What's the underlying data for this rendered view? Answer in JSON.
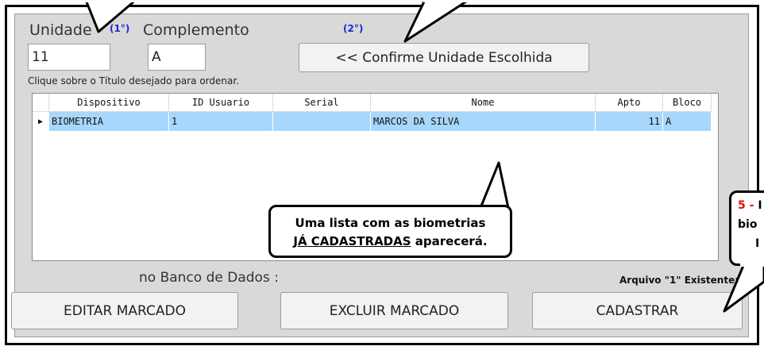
{
  "form": {
    "unidade_label": "Unidade",
    "unidade_tag": "(1°)",
    "complemento_label": "Complemento",
    "confirm_tag": "(2°)",
    "unidade_value": "11",
    "complemento_value": "A",
    "confirm_button": "<< Confirme Unidade Escolhida",
    "sort_hint": "Clique sobre o Título desejado para ordenar."
  },
  "grid": {
    "columns": [
      "Dispositivo",
      "ID Usuario",
      "Serial",
      "Nome",
      "Apto",
      "Bloco"
    ],
    "rows": [
      {
        "dispositivo": "BIOMETRIA",
        "id_usuario": "1",
        "serial": "",
        "nome": "MARCOS DA SILVA",
        "apto": "11",
        "bloco": "A"
      }
    ]
  },
  "status": {
    "banco_label": "no Banco de Dados :",
    "arquivo_label": "Arquivo \"1\" Existente:"
  },
  "actions": {
    "editar": "EDITAR MARCADO",
    "excluir": "EXCLUIR MARCADO",
    "cadastrar": "CADASTRAR"
  },
  "annotations": {
    "callout_line1": "Uma lista com as biometrias",
    "callout_line2_underlined": "JÁ CADASTRADAS",
    "callout_line2_rest": " aparecerá.",
    "side_step_number": "5 -",
    "side_line1_text": "I",
    "side_line2": "bio",
    "side_line3": "I"
  },
  "colors": {
    "selected_row": "#a8d7fb",
    "tag_blue": "#1a2bd6",
    "step_red": "#e01010"
  }
}
